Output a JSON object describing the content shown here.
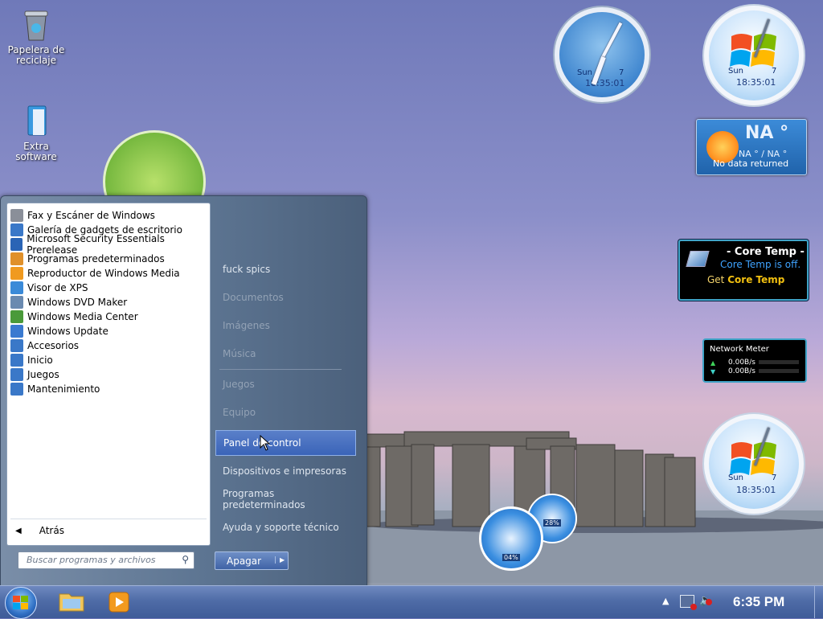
{
  "desktop": {
    "icons": [
      {
        "label": "Papelera de reciclaje",
        "icon": "recycle-bin-icon"
      },
      {
        "label": "Extra software",
        "icon": "folder-icon"
      }
    ]
  },
  "gadgets": {
    "clock_small": {
      "day": "Sun",
      "date": "7",
      "time": "18:35:01"
    },
    "clock_top_right": {
      "day": "Sun",
      "date": "7",
      "time": "18:35:01"
    },
    "clock_bottom_right": {
      "day": "Sun",
      "date": "7",
      "time": "18:35:01"
    },
    "weather": {
      "temp": "NA °",
      "range": "NA ° / NA °",
      "status": "No data returned"
    },
    "coretemp": {
      "title": "- Core Temp -",
      "status": "Core Temp is off.",
      "get_prefix": "Get",
      "get_link": "Core Temp"
    },
    "network": {
      "title": "Network Meter",
      "up": "0.00B/s",
      "down": "0.00B/s"
    },
    "cpu_meter": {
      "cpu1": "04%",
      "cpu2": "28%"
    }
  },
  "start_menu": {
    "programs": [
      {
        "label": "Fax y Escáner de Windows",
        "color": "#8a8f99"
      },
      {
        "label": "Galería de gadgets de escritorio",
        "color": "#3a78c8"
      },
      {
        "label": "Microsoft Security Essentials Prerelease",
        "color": "#2a64b5"
      },
      {
        "label": "Programas predeterminados",
        "color": "#e0902a"
      },
      {
        "label": "Reproductor de Windows Media",
        "color": "#f09a20"
      },
      {
        "label": "Visor de XPS",
        "color": "#3a8ad8"
      },
      {
        "label": "Windows DVD Maker",
        "color": "#6a8ab0"
      },
      {
        "label": "Windows Media Center",
        "color": "#4a9a3a"
      },
      {
        "label": "Windows Update",
        "color": "#3a7ad0"
      },
      {
        "label": "Accesorios",
        "color": "#3a78c8"
      },
      {
        "label": "Inicio",
        "color": "#3a78c8"
      },
      {
        "label": "Juegos",
        "color": "#3a78c8"
      },
      {
        "label": "Mantenimiento",
        "color": "#3a78c8"
      }
    ],
    "back_label": "Atrás",
    "search_placeholder": "Buscar programas y archivos",
    "right_items": [
      {
        "label": "fuck spics"
      },
      {
        "label": "Documentos"
      },
      {
        "label": "Imágenes"
      },
      {
        "label": "Música"
      },
      {
        "label": "Juegos"
      },
      {
        "label": "Equipo"
      },
      {
        "label": "Panel de control"
      },
      {
        "label": "Dispositivos e impresoras"
      },
      {
        "label": "Programas predeterminados"
      },
      {
        "label": "Ayuda y soporte técnico"
      }
    ],
    "shutdown_label": "Apagar"
  },
  "taskbar": {
    "clock": "6:35 PM"
  }
}
